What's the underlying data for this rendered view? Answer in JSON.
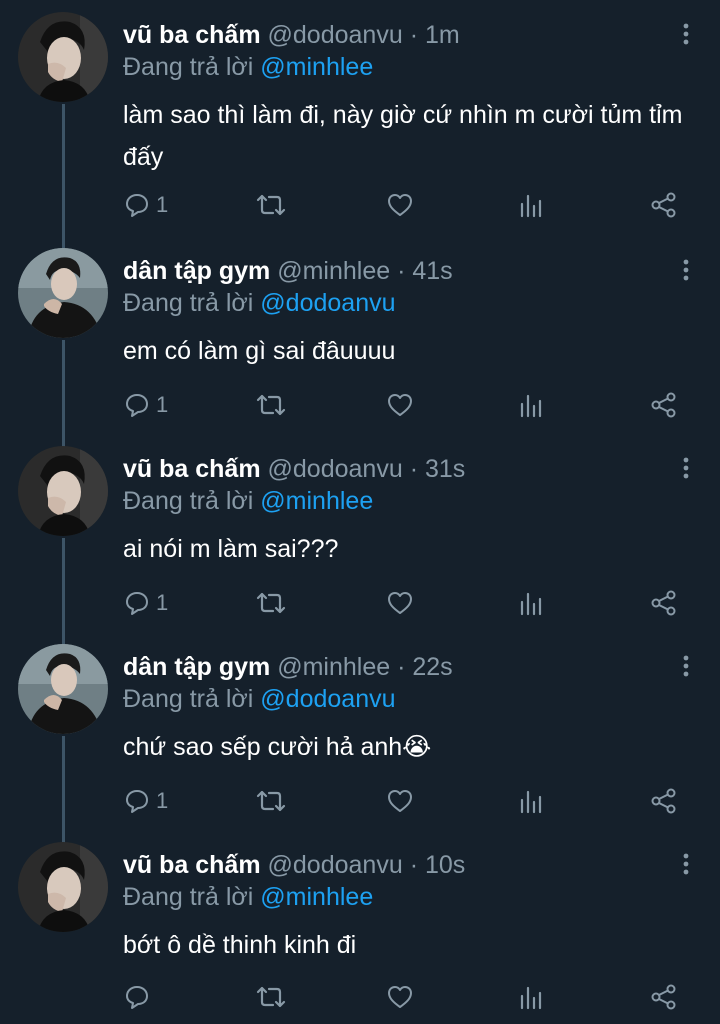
{
  "tweets": [
    {
      "name": "vũ ba chấm",
      "handle": "@dodoanvu",
      "time": "1m",
      "reply_prefix": "Đang trả lời",
      "reply_to": "@minhlee",
      "text": "làm sao thì làm đi, này giờ cứ nhìn m cười tủm tỉm đấy",
      "reply_count": "1",
      "avatar_icon": "avatar-vu"
    },
    {
      "name": "dân tập gym",
      "handle": "@minhlee",
      "time": "41s",
      "reply_prefix": "Đang trả lời",
      "reply_to": "@dodoanvu",
      "text": "em có làm gì sai đâuuuu",
      "reply_count": "1",
      "avatar_icon": "avatar-minh"
    },
    {
      "name": "vũ ba chấm",
      "handle": "@dodoanvu",
      "time": "31s",
      "reply_prefix": "Đang trả lời",
      "reply_to": "@minhlee",
      "text": "ai nói m làm sai???",
      "reply_count": "1",
      "avatar_icon": "avatar-vu"
    },
    {
      "name": "dân tập gym",
      "handle": "@minhlee",
      "time": "22s",
      "reply_prefix": "Đang trả lời",
      "reply_to": "@dodoanvu",
      "text": "chứ sao sếp cười hả anh😭",
      "reply_count": "1",
      "avatar_icon": "avatar-minh"
    },
    {
      "name": "vũ ba chấm",
      "handle": "@dodoanvu",
      "time": "10s",
      "reply_prefix": "Đang trả lời",
      "reply_to": "@minhlee",
      "text": "bớt ô dề thinh kinh đi",
      "reply_count": "",
      "avatar_icon": "avatar-vu"
    }
  ],
  "separator": "·",
  "icons": [
    "reply-icon",
    "retweet-icon",
    "like-icon",
    "analytics-icon",
    "share-icon",
    "more-icon"
  ],
  "colors": {
    "background": "#15202b",
    "text": "#ffffff",
    "muted": "#8899a6",
    "accent": "#1da1f2",
    "thread_line": "#3d5466"
  }
}
